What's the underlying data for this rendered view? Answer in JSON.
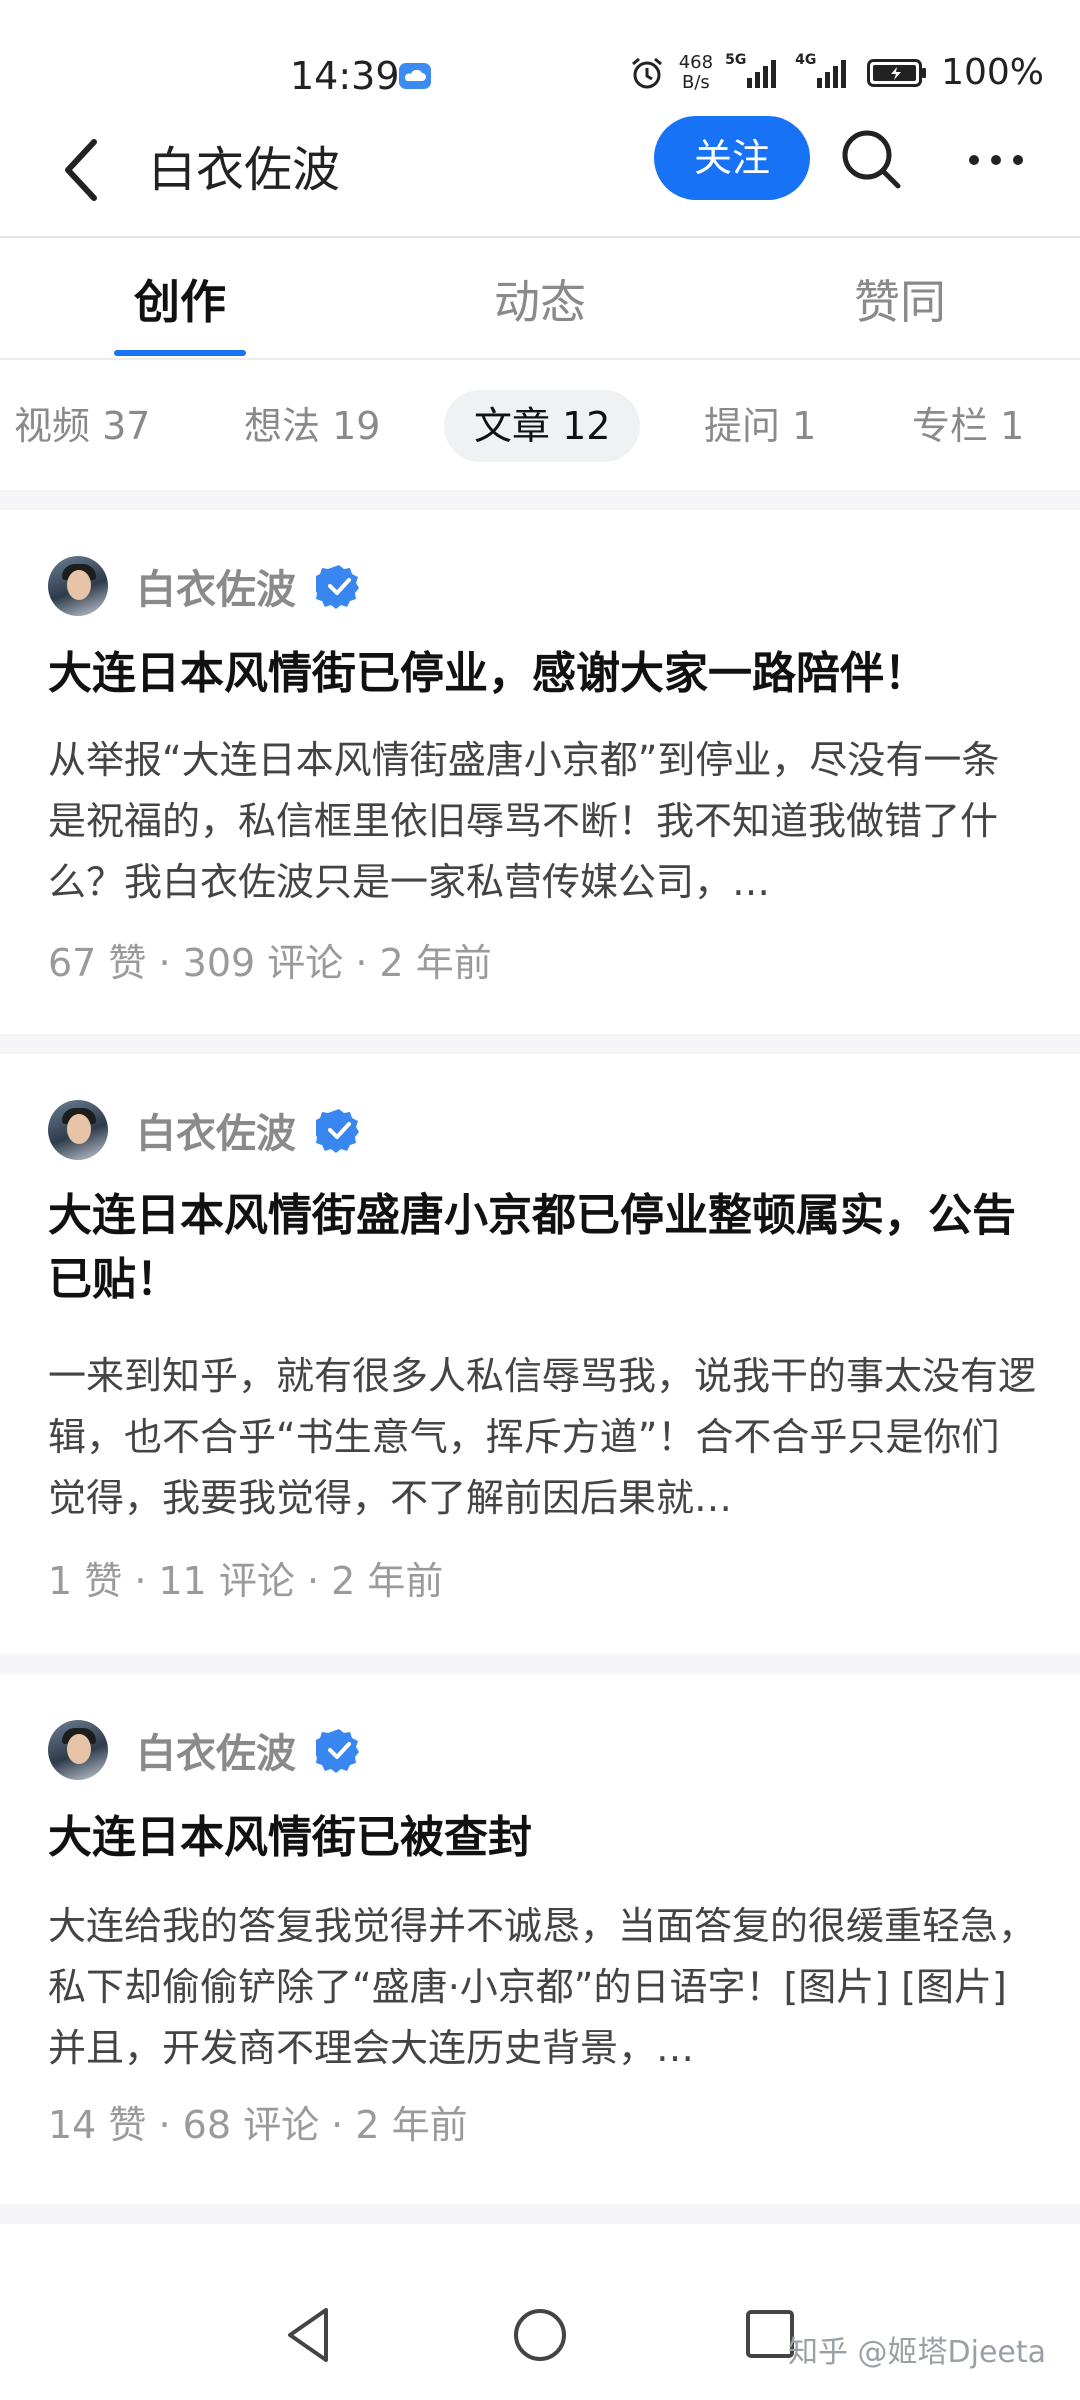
{
  "status_bar": {
    "time": "14:39",
    "net_speed_top": "468",
    "net_speed_bottom": "B/s",
    "signal1_label": "5G",
    "signal2_label": "4G",
    "battery": "100%"
  },
  "header": {
    "title": "白衣佐波",
    "follow_label": "关注",
    "icons": [
      "back-arrow-icon",
      "search-icon",
      "more-icon"
    ]
  },
  "main_tabs": [
    {
      "label": "创作",
      "active": true
    },
    {
      "label": "动态",
      "active": false
    },
    {
      "label": "赞同",
      "active": false
    }
  ],
  "sub_tabs": [
    {
      "label": "视频 37",
      "active": false
    },
    {
      "label": "想法 19",
      "active": false
    },
    {
      "label": "文章 12",
      "active": true
    },
    {
      "label": "提问 1",
      "active": false
    },
    {
      "label": "专栏 1",
      "active": false
    }
  ],
  "articles": [
    {
      "author": "白衣佐波",
      "title": "大连日本风情街已停业，感谢大家一路陪伴！",
      "excerpt": "从举报“大连日本风情街盛唐小京都”到停业，尽没有一条是祝福的，私信框里依旧辱骂不断！我不知道我做错了什么？我白衣佐波只是一家私营传媒公司，…",
      "meta": "67 赞 · 309 评论 · 2 年前"
    },
    {
      "author": "白衣佐波",
      "title": "大连日本风情街盛唐小京都已停业整顿属实，公告已贴！",
      "excerpt": "一来到知乎，就有很多人私信辱骂我，说我干的事太没有逻辑，也不合乎“书生意气，挥斥方遒”！合不合乎只是你们觉得，我要我觉得，不了解前因后果就…",
      "meta": "1 赞 · 11 评论 · 2 年前"
    },
    {
      "author": "白衣佐波",
      "title": "大连日本风情街已被查封",
      "excerpt": "大连给我的答复我觉得并不诚恳，当面答复的很缓重轻急，私下却偷偷铲除了“盛唐·小京都”的日语字！[图片] [图片] 并且，开发商不理会大连历史背景，…",
      "meta": "14 赞 · 68 评论 · 2 年前"
    }
  ],
  "watermark": "知乎 @姬塔Djeeta",
  "colors": {
    "accent": "#1772f6",
    "verified": "#1772f6"
  }
}
